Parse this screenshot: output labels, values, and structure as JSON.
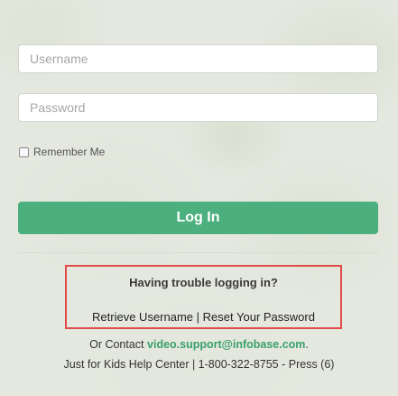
{
  "form": {
    "username_placeholder": "Username",
    "password_placeholder": "Password",
    "remember_label": "Remember Me",
    "login_label": "Log In"
  },
  "trouble": {
    "title": "Having trouble logging in?",
    "retrieve_username": "Retrieve Username",
    "separator": "|",
    "reset_password": "Reset Your Password"
  },
  "contact": {
    "prefix": "Or Contact",
    "email": "video.support@infobase.com",
    "suffix": ".",
    "help_line": "Just for Kids Help Center | 1-800-322-8755 - Press (6)"
  },
  "colors": {
    "accent": "#4baf7e",
    "highlight_border": "#e24a4a",
    "link": "#3aa06c"
  }
}
